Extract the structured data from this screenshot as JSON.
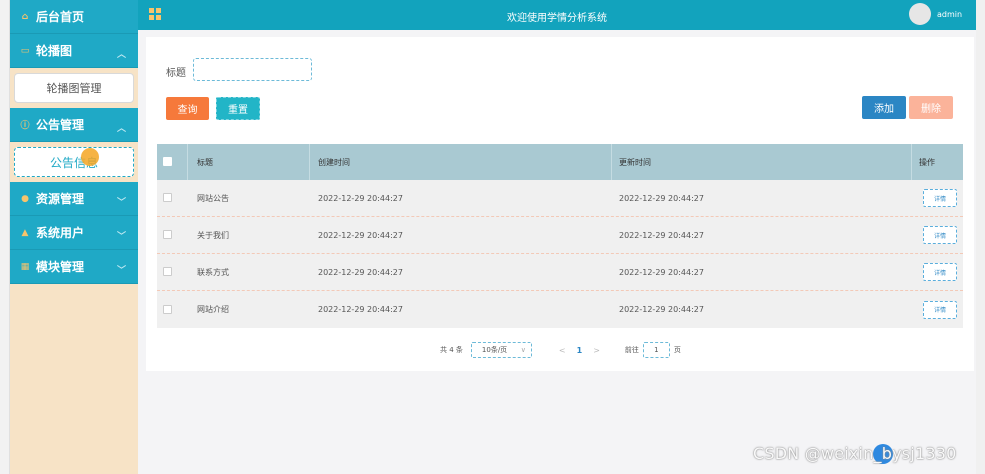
{
  "header": {
    "title": "欢迎使用学情分析系统",
    "user": "admin"
  },
  "sidebar": {
    "items": [
      {
        "label": "后台首页",
        "icon": "home-icon"
      },
      {
        "label": "轮播图",
        "icon": "image-icon",
        "sub": "轮播图管理"
      },
      {
        "label": "公告管理",
        "icon": "info-icon",
        "sub": "公告信息"
      },
      {
        "label": "资源管理",
        "icon": "pin-icon"
      },
      {
        "label": "系统用户",
        "icon": "user-icon"
      },
      {
        "label": "模块管理",
        "icon": "grid-icon"
      }
    ]
  },
  "search": {
    "label": "标题",
    "value": "",
    "placeholder": ""
  },
  "buttons": {
    "query": "查询",
    "reset": "重置",
    "add": "添加",
    "delete": "删除"
  },
  "table": {
    "headers": [
      "标题",
      "创建时间",
      "更新时间",
      "操作"
    ],
    "rows": [
      {
        "title": "网站公告",
        "created": "2022-12-29 20:44:27",
        "updated": "2022-12-29 20:44:27",
        "action": "详情"
      },
      {
        "title": "关于我们",
        "created": "2022-12-29 20:44:27",
        "updated": "2022-12-29 20:44:27",
        "action": "详情"
      },
      {
        "title": "联系方式",
        "created": "2022-12-29 20:44:27",
        "updated": "2022-12-29 20:44:27",
        "action": "详情"
      },
      {
        "title": "网站介绍",
        "created": "2022-12-29 20:44:27",
        "updated": "2022-12-29 20:44:27",
        "action": "详情"
      }
    ]
  },
  "pager": {
    "total": "共 4 条",
    "size": "10条/页",
    "prev": "<",
    "current": "1",
    "next": ">",
    "goto": "前往",
    "page_value": "1",
    "page_unit": "页"
  },
  "watermark": "CSDN @weixin_bysj1330",
  "colors": {
    "header": "#12a3bd",
    "menu": "#1fa9c6",
    "sidebar_bg": "#f7e3c6",
    "query": "#f6793b",
    "add": "#2b86c4",
    "delete": "#fbb39a"
  }
}
